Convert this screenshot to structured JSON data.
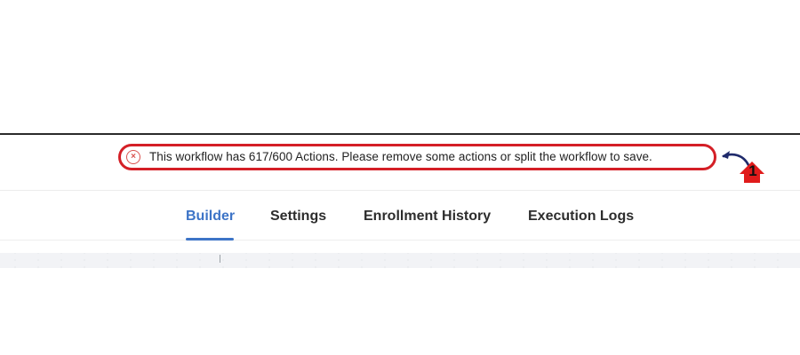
{
  "error_banner": {
    "icon": "x-circle-icon",
    "message": "This workflow has 617/600 Actions. Please remove some actions or split the workflow to save."
  },
  "annotation": {
    "number": "1",
    "callout_color": "#d41f26",
    "arrow_color": "#1f2a6b",
    "home_arrow_color": "#e01b1b"
  },
  "tabs": [
    {
      "label": "Builder",
      "active": true
    },
    {
      "label": "Settings",
      "active": false
    },
    {
      "label": "Enrollment History",
      "active": false
    },
    {
      "label": "Execution Logs",
      "active": false
    }
  ],
  "colors": {
    "active_tab": "#3d74c7",
    "tab_text": "#2d2d2d",
    "error_icon": "#d9534f"
  }
}
